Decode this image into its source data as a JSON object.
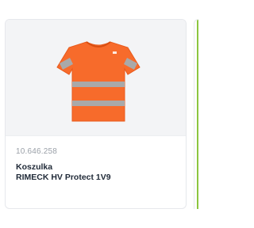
{
  "product_card": {
    "image_alt": "Koszulka RIMECK HV Protect 1V9",
    "sku": "10.646.258",
    "name_line1": "Koszulka",
    "name_line2": "RIMECK HV Protect 1V9",
    "shirt_color": "#f76b2b",
    "reflective_color": "#a9a9a9",
    "image_bg": "#f3f4f6"
  },
  "accent_color": "#8cc63f"
}
